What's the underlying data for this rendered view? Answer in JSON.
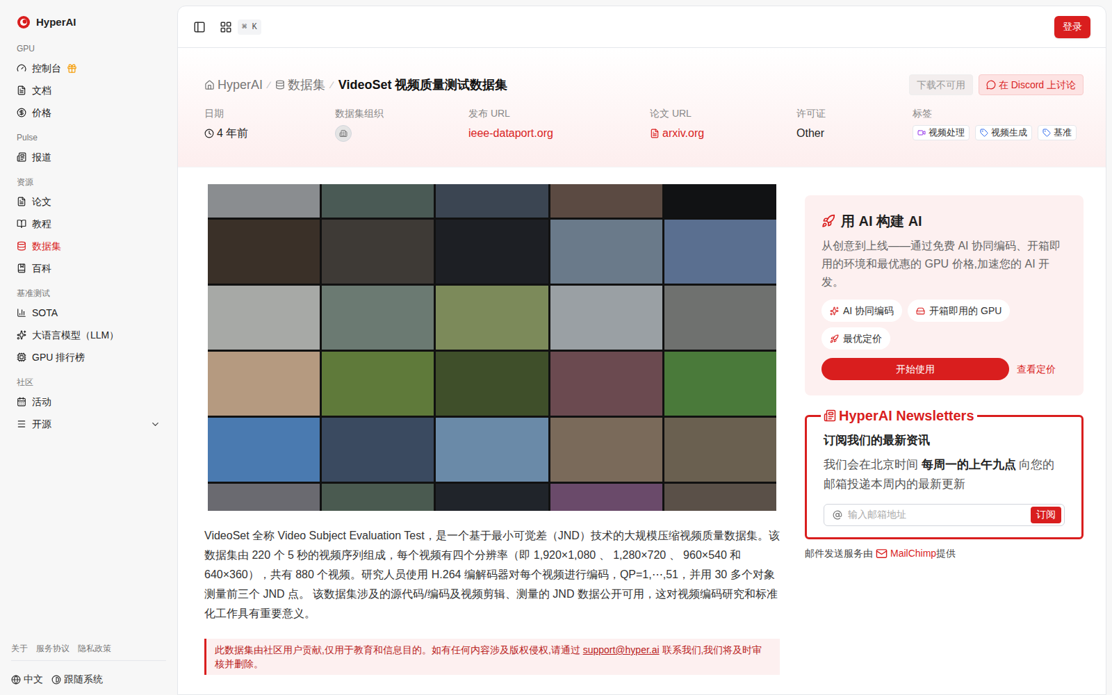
{
  "sidebar": {
    "brand": "HyperAI",
    "sections": [
      {
        "label": "GPU",
        "items": [
          {
            "label": "控制台",
            "selected": false,
            "badge": true
          },
          {
            "label": "文档",
            "selected": false,
            "badge": false
          },
          {
            "label": "价格",
            "selected": false,
            "badge": false
          }
        ]
      },
      {
        "label": "Pulse",
        "items": [
          {
            "label": "报道",
            "selected": false,
            "badge": false
          }
        ]
      },
      {
        "label": "资源",
        "items": [
          {
            "label": "论文",
            "selected": false,
            "badge": false
          },
          {
            "label": "教程",
            "selected": false,
            "badge": false
          },
          {
            "label": "数据集",
            "selected": true,
            "badge": false
          },
          {
            "label": "百科",
            "selected": false,
            "badge": false
          }
        ]
      },
      {
        "label": "基准测试",
        "items": [
          {
            "label": "SOTA",
            "selected": false,
            "badge": false
          },
          {
            "label": "大语言模型（LLM）",
            "selected": false,
            "badge": false
          },
          {
            "label": "GPU 排行榜",
            "selected": false,
            "badge": false
          }
        ]
      },
      {
        "label": "社区",
        "items": [
          {
            "label": "活动",
            "selected": false,
            "badge": false
          },
          {
            "label": "开源",
            "selected": false,
            "badge": false,
            "expandable": true
          }
        ]
      }
    ],
    "footer_links": [
      "关于",
      "服务协议",
      "隐私政策"
    ],
    "language": "中文",
    "theme": "跟随系统"
  },
  "topbar": {
    "shortcut": "⌘ K",
    "login": "登录"
  },
  "breadcrumb": [
    "HyperAI",
    "数据集",
    "VideoSet 视频质量测试数据集"
  ],
  "header_buttons": [
    {
      "label": "下载不可用",
      "disabled": true
    },
    {
      "label": "在 Discord 上讨论",
      "disabled": false
    }
  ],
  "meta": {
    "date_label": "日期",
    "date": "4 年前",
    "org_label": "数据集组织",
    "publish_label": "发布 URL",
    "publish_url": "ieee-dataport.org",
    "paper_label": "论文 URL",
    "paper_url": "arxiv.org",
    "license_label": "许可证",
    "license": "Other",
    "tags_label": "标签",
    "tags": [
      {
        "label": "视频处理",
        "kind": "video",
        "color": "#9333ea"
      },
      {
        "label": "视频生成",
        "kind": "tag",
        "color": "#2563eb"
      },
      {
        "label": "基准",
        "kind": "tag",
        "color": "#2563eb"
      }
    ]
  },
  "description": "VideoSet 全称 Video Subject Evaluation Test，是一个基于最小可觉差（JND）技术的大规模压缩视频质量数据集。该数据集由 220 个 5 秒的视频序列组成，每个视频有四个分辨率（即 1,920×1,080 、 1,280×720 、 960×540 和 640×360），共有 880 个视频。研究人员使用 H.264 编解码器对每个视频进行编码，QP=1,⋯,51，并用 30 多个对象测量前三个 JND 点。 该数据集涉及的源代码/编码及视频剪辑、测量的 JND 数据公开可用，这对视频编码研究和标准化工作具有重要意义。",
  "notice": {
    "before": "此数据集由社区用户贡献,仅用于教育和信息目的。如有任何内容涉及版权侵权,请通过 ",
    "email": "support@hyper.ai",
    "after": " 联系我们,我们将及时审核并删除。"
  },
  "promo": {
    "title": "用 AI 构建 AI",
    "text": "从创意到上线——通过免费 AI 协同编码、开箱即用的环境和最优惠的 GPU 价格,加速您的 AI 开发。",
    "chips": [
      "AI 协同编码",
      "开箱即用的 GPU",
      "最优定价"
    ],
    "start": "开始使用",
    "pricing": "查看定价"
  },
  "newsletter": {
    "title": "HyperAI Newsletters",
    "heading": "订阅我们的最新资讯",
    "text_before": "我们会在北京时间 ",
    "text_bold": "每周一的上午九点",
    "text_after": " 向您的邮箱投递本周内的最新更新",
    "placeholder": "输入邮箱地址",
    "button": "订阅",
    "credit_before": "邮件发送服务由 ",
    "credit_link": "MailChimp",
    "credit_after": " 提供"
  }
}
